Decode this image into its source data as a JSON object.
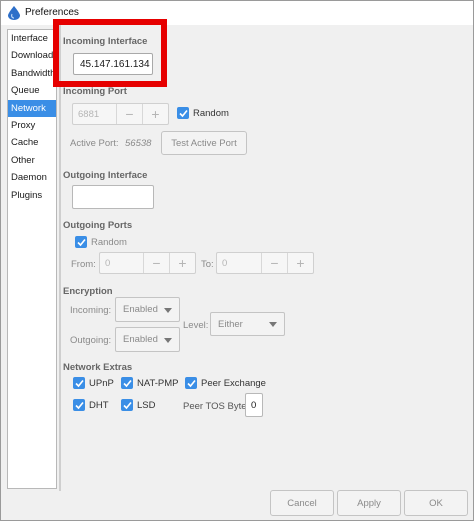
{
  "window": {
    "title": "Preferences"
  },
  "sidebar": {
    "items": [
      {
        "label": "Interface"
      },
      {
        "label": "Downloads"
      },
      {
        "label": "Bandwidth"
      },
      {
        "label": "Queue"
      },
      {
        "label": "Network",
        "selected": true
      },
      {
        "label": "Proxy"
      },
      {
        "label": "Cache"
      },
      {
        "label": "Other"
      },
      {
        "label": "Daemon"
      },
      {
        "label": "Plugins"
      }
    ]
  },
  "incoming_interface": {
    "label": "Incoming Interface",
    "value": "45.147.161.134"
  },
  "incoming_port": {
    "label": "Incoming Port",
    "port_value": "6881",
    "random_label": "Random",
    "random_checked": true,
    "active_port_label": "Active Port:",
    "active_port_value": "56538",
    "test_button": "Test Active Port",
    "minus": "−",
    "plus": "+"
  },
  "outgoing_interface": {
    "label": "Outgoing Interface",
    "value": ""
  },
  "outgoing_ports": {
    "label": "Outgoing Ports",
    "random_label": "Random",
    "random_checked": true,
    "from_label": "From:",
    "from_value": "0",
    "to_label": "To:",
    "to_value": "0",
    "minus": "−",
    "plus": "+"
  },
  "encryption": {
    "label": "Encryption",
    "incoming_label": "Incoming:",
    "incoming_value": "Enabled",
    "outgoing_label": "Outgoing:",
    "outgoing_value": "Enabled",
    "level_label": "Level:",
    "level_value": "Either"
  },
  "network_extras": {
    "label": "Network Extras",
    "upnp": "UPnP",
    "natpmp": "NAT-PMP",
    "peer_exchange": "Peer Exchange",
    "dht": "DHT",
    "lsd": "LSD",
    "peer_tos_label": "Peer TOS Byte:",
    "peer_tos_value": "0"
  },
  "buttons": {
    "cancel": "Cancel",
    "apply": "Apply",
    "ok": "OK"
  },
  "colors": {
    "accent": "#3a8ee6",
    "highlight": "#e60000"
  }
}
